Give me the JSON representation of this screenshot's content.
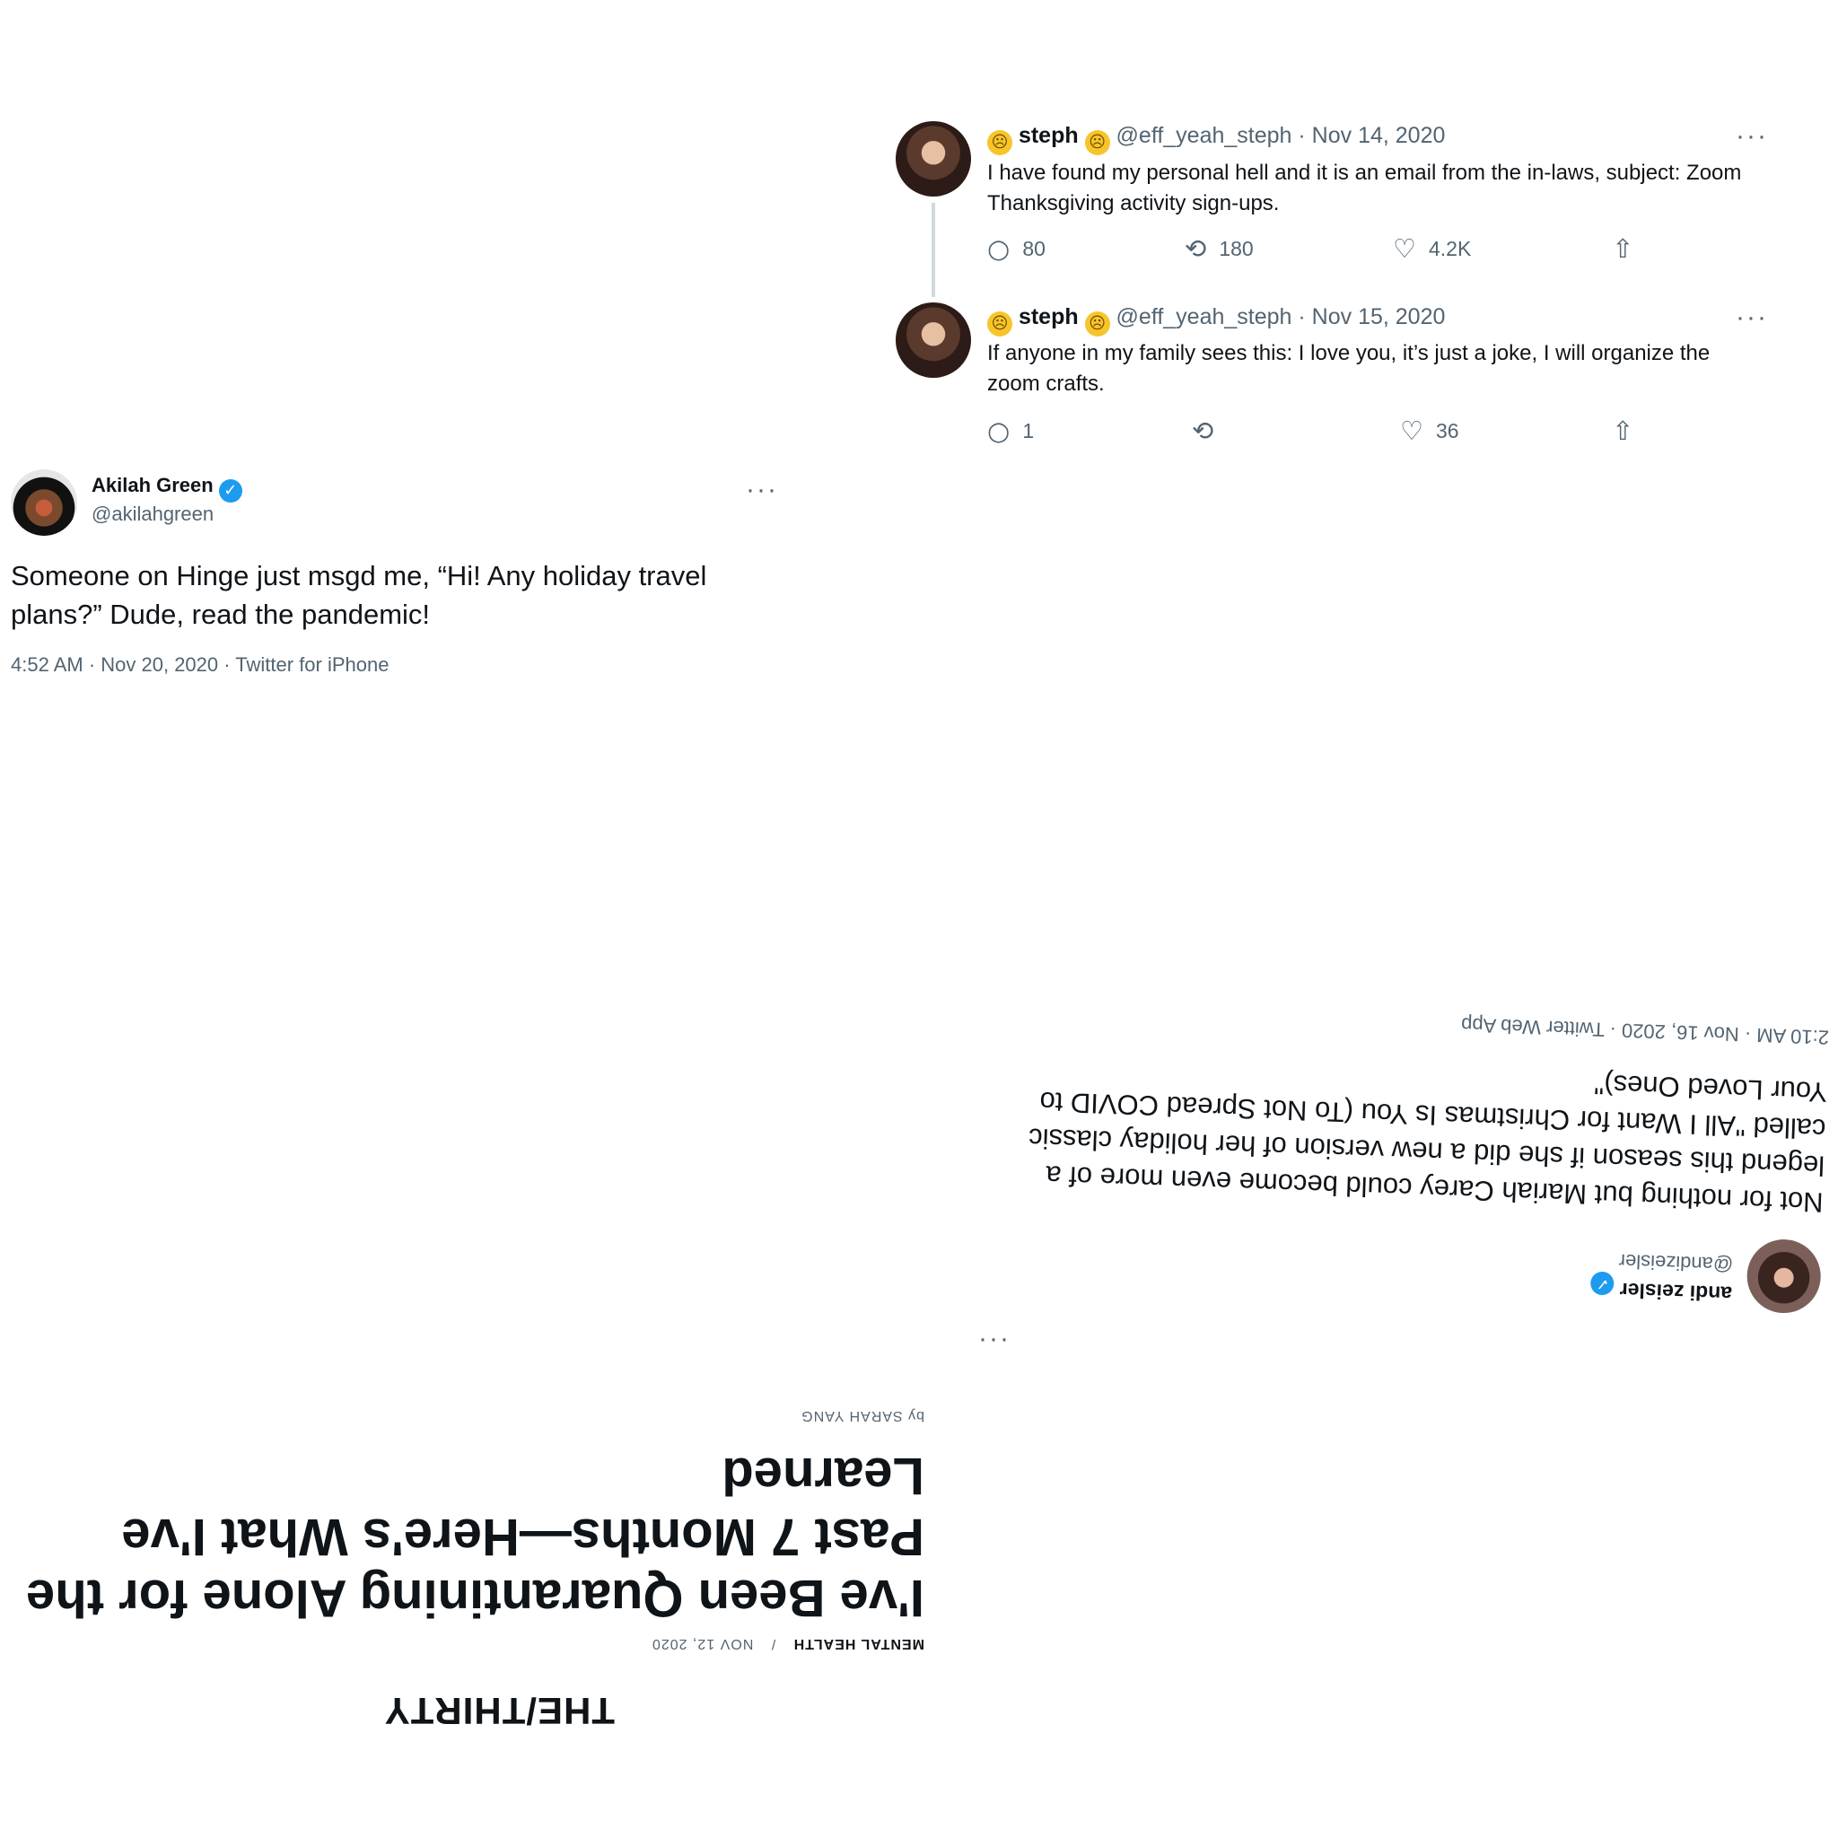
{
  "thread": {
    "tweets": [
      {
        "name": "steph",
        "handle": "@eff_yeah_steph",
        "date": "· Nov 14, 2020",
        "text": "I have found my personal hell and it is an email from the in-laws, subject:  Zoom Thanksgiving activity sign-ups.",
        "replies": "80",
        "retweets": "180",
        "likes": "4.2K"
      },
      {
        "name": "steph",
        "handle": "@eff_yeah_steph",
        "date": "· Nov 15, 2020",
        "text": "If anyone in my family sees this: I love you, it’s just a joke, I will organize the zoom crafts.",
        "replies": "1",
        "retweets": "",
        "likes": "36"
      }
    ]
  },
  "akilah": {
    "name": "Akilah Green",
    "handle": "@akilahgreen",
    "text": "Someone on Hinge just msgd me, “Hi! Any holiday travel plans?” Dude, read the pandemic!",
    "meta": "4:52 AM · Nov 20, 2020 · Twitter for iPhone"
  },
  "andi": {
    "name": "andi zeisler",
    "handle": "@andizeisler",
    "text": "Not for nothing but Mariah Carey could become even more of a legend this season if she did a new version of her holiday classic called \"All I Want for Christmas Is You (To Not Spread COVID to Your Loved Ones)\"",
    "meta": "2:10 AM · Nov 16, 2020 · Twitter Web App"
  },
  "article": {
    "brand": "THE/THIRTY",
    "category": "MENTAL HEALTH",
    "separator": "/",
    "date": "NOV 12, 2020",
    "title": "I've Been Quarantining Alone for the Past 7 Months—Here's What I've Learned",
    "byline": "by SARAH YANG"
  },
  "icons": {
    "more": "···",
    "reply": "○",
    "retweet": "⟲",
    "like": "♡",
    "share": "⇧",
    "verified": "✓",
    "emoji": "☹"
  }
}
